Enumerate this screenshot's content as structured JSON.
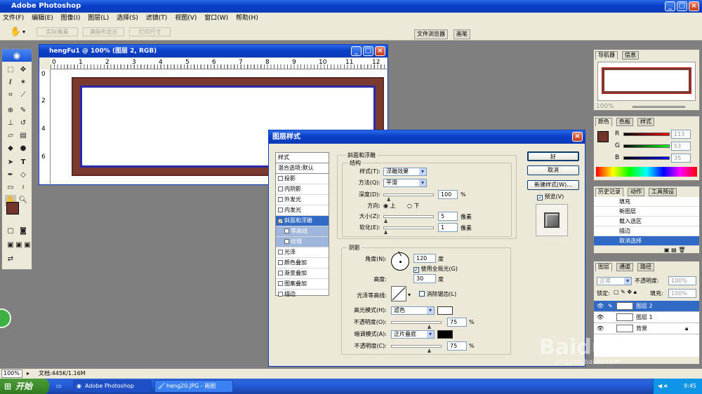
{
  "app": {
    "title": "Adobe Photoshop"
  },
  "menu": [
    "文件(F)",
    "编辑(E)",
    "图像(I)",
    "图层(L)",
    "选择(S)",
    "滤镜(T)",
    "视图(V)",
    "窗口(W)",
    "帮助(H)"
  ],
  "options": {
    "buttons": [
      "实际像素",
      "满画布显示",
      "打印尺寸"
    ],
    "wells": [
      "文件浏览器",
      "画笔"
    ]
  },
  "document": {
    "title": "hengFu1 @ 100% (图层 2, RGB)",
    "ruler_top": [
      "0",
      "1",
      "2",
      "3",
      "4",
      "5",
      "6",
      "7",
      "8",
      "9",
      "10",
      "11",
      "12"
    ],
    "ruler_left": [
      "0",
      "2",
      "4",
      "6"
    ]
  },
  "navigator": {
    "tabs": [
      "导航器",
      "信息"
    ],
    "zoom": "100%"
  },
  "color_panel": {
    "tabs": [
      "颜色",
      "色板",
      "样式"
    ],
    "channels": [
      {
        "label": "R",
        "value": "113"
      },
      {
        "label": "G",
        "value": "53"
      },
      {
        "label": "B",
        "value": "35"
      }
    ]
  },
  "history": {
    "tabs": [
      "历史记录",
      "动作",
      "工具预设"
    ],
    "items": [
      "填充",
      "新图层",
      "载入选区",
      "描边",
      "取消选择"
    ],
    "selected_index": 4
  },
  "layers": {
    "tabs": [
      "图层",
      "通道",
      "路径"
    ],
    "blend_mode": "正常",
    "opacity_label": "不透明度:",
    "opacity": "100%",
    "lock_label": "锁定:",
    "fill_label": "填充:",
    "fill": "100%",
    "items": [
      "图层 2",
      "图层 1",
      "背景"
    ],
    "selected_index": 0
  },
  "dialog": {
    "title": "图层样式",
    "styles": [
      "样式",
      "混合选项:默认",
      "投影",
      "内阴影",
      "外发光",
      "内发光",
      "斜面和浮雕",
      "等高线",
      "纹理",
      "光泽",
      "颜色叠加",
      "渐变叠加",
      "图案叠加",
      "描边"
    ],
    "bevel": {
      "group_title": "斜面和浮雕",
      "structure_title": "结构",
      "style_label": "样式(T):",
      "style_value": "浮雕效果",
      "technique_label": "方法(Q):",
      "technique_value": "平滑",
      "depth_label": "深度(D):",
      "depth_value": "100",
      "depth_unit": "%",
      "depth_level": 0.1,
      "direction_label": "方向:",
      "direction_up": "上",
      "direction_down": "下",
      "size_label": "大小(Z):",
      "size_value": "5",
      "size_unit": "像素",
      "soften_label": "软化(E):",
      "soften_value": "1",
      "soften_unit": "像素"
    },
    "shading": {
      "title": "阴影",
      "angle_label": "角度(N):",
      "angle_value": "120",
      "angle_unit": "度",
      "global_light": "使用全局光(G)",
      "altitude_label": "高度:",
      "altitude_value": "30",
      "altitude_unit": "度",
      "gloss_label": "光泽等高线:",
      "antialias": "消除锯齿(L)",
      "highlight_label": "高光模式(H):",
      "highlight_mode": "滤色",
      "highlight_color": "#ffffff",
      "hl_opacity_label": "不透明度(O):",
      "hl_opacity": "75",
      "shadow_label": "暗调模式(A):",
      "shadow_mode": "正片叠底",
      "shadow_color": "#000000",
      "sh_opacity_label": "不透明度(C):",
      "sh_opacity": "75",
      "pct": "%"
    },
    "buttons": {
      "ok": "好",
      "cancel": "取消",
      "new_style": "新建样式(W)...",
      "preview": "预览(V)"
    }
  },
  "status": {
    "zoom": "100%",
    "doc": "文档:445K/1.16M"
  },
  "taskbar": {
    "start": "开始",
    "tasks": [
      "Adobe Photoshop",
      "heng20.JPG - 画图"
    ],
    "clock": "9:45"
  },
  "watermark": {
    "brand": "Baidu经验",
    "url": "jingyan.baidu.com"
  },
  "colors": {
    "frame": "#7b3a2f",
    "frame_border": "#2a2aa8",
    "fg_swatch": "#71352",
    "selection": "#316ac5"
  }
}
